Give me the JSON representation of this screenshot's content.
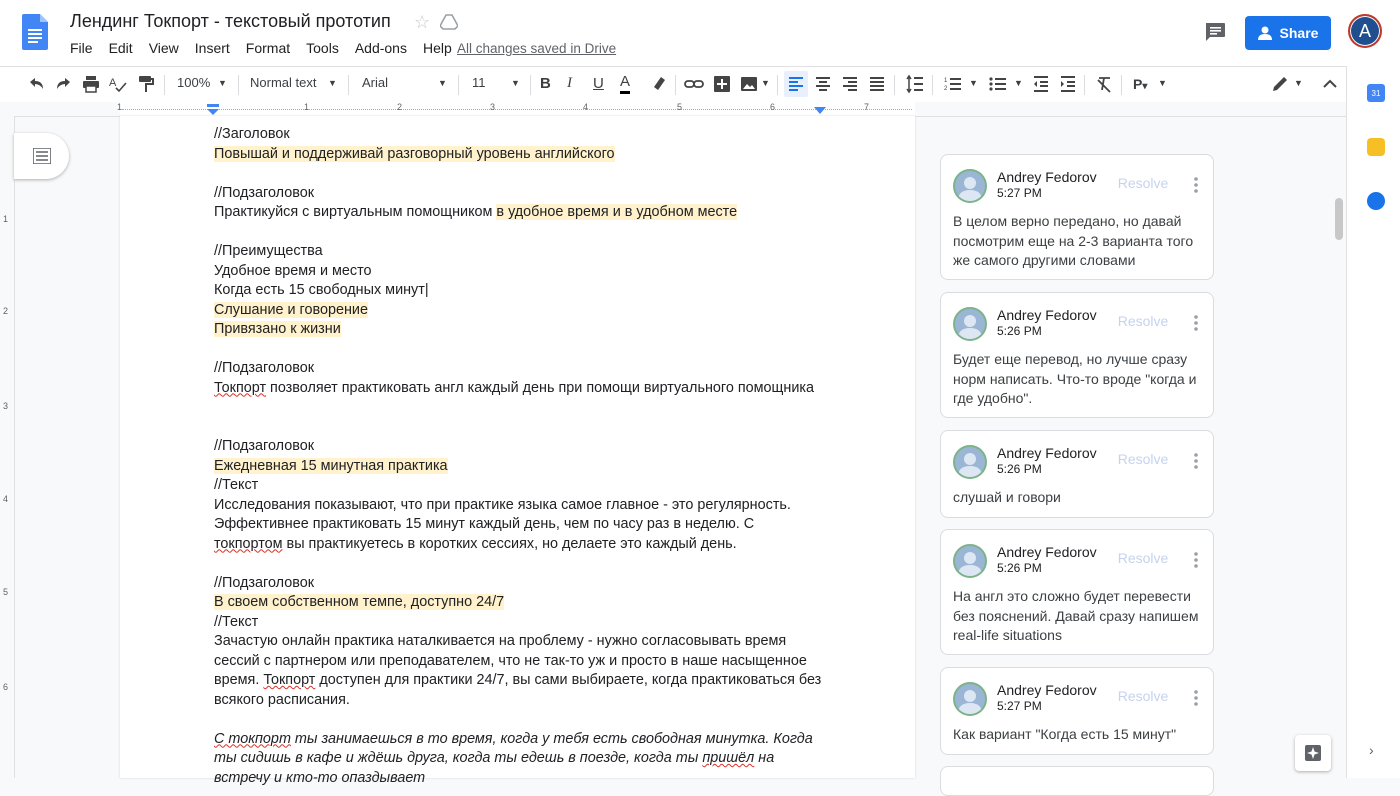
{
  "document": {
    "title": "Лендинг Токпорт - текстовый прототип",
    "saved_status": "All changes saved in Drive"
  },
  "menu": [
    "File",
    "Edit",
    "View",
    "Insert",
    "Format",
    "Tools",
    "Add-ons",
    "Help"
  ],
  "share_label": "Share",
  "user_initial": "A",
  "toolbar": {
    "zoom": "100%",
    "style": "Normal text",
    "font": "Arial",
    "size": "11"
  },
  "ruler_numbers": [
    "1",
    "1",
    "2",
    "3",
    "4",
    "5",
    "6",
    "7"
  ],
  "vruler_numbers": [
    "1",
    "2",
    "3",
    "4",
    "5",
    "6"
  ],
  "doc_lines": [
    {
      "segments": [
        {
          "text": "//Заголовок"
        }
      ]
    },
    {
      "segments": [
        {
          "text": "Повышай и поддерживай разговорный уровень английского",
          "hl": true
        }
      ]
    },
    {
      "segments": [
        {
          "text": ""
        }
      ]
    },
    {
      "segments": [
        {
          "text": "//Подзаголовок"
        }
      ]
    },
    {
      "segments": [
        {
          "text": "Практикуйся с виртуальным помощником "
        },
        {
          "text": "в удобное время и в удобном месте",
          "hl": true
        }
      ]
    },
    {
      "segments": [
        {
          "text": ""
        }
      ]
    },
    {
      "segments": [
        {
          "text": "//Преимущества"
        }
      ]
    },
    {
      "segments": [
        {
          "text": "Удобное время и место"
        }
      ]
    },
    {
      "segments": [
        {
          "text": "Когда есть 15 свободных минут|"
        }
      ]
    },
    {
      "segments": [
        {
          "text": "Слушание и говорение",
          "hl": true
        }
      ]
    },
    {
      "segments": [
        {
          "text": "Привязано к жизни",
          "hl": true
        }
      ]
    },
    {
      "segments": [
        {
          "text": ""
        }
      ]
    },
    {
      "segments": [
        {
          "text": "//Подзаголовок"
        }
      ]
    },
    {
      "segments": [
        {
          "text": "Токпорт",
          "sq": true
        },
        {
          "text": " позволяет практиковать англ каждый день при помощи виртуального помощника"
        }
      ]
    },
    {
      "segments": [
        {
          "text": ""
        }
      ]
    },
    {
      "segments": [
        {
          "text": ""
        }
      ]
    },
    {
      "segments": [
        {
          "text": "//Подзаголовок"
        }
      ]
    },
    {
      "segments": [
        {
          "text": "Ежедневная 15 минутная практика",
          "hl": true
        }
      ]
    },
    {
      "segments": [
        {
          "text": "//Текст"
        }
      ]
    },
    {
      "segments": [
        {
          "text": "Исследования показывают, что при практике языка самое главное - это регулярность."
        }
      ]
    },
    {
      "segments": [
        {
          "text": "Эффективнее практиковать 15 минут каждый день, чем по часу раз в неделю. С"
        }
      ]
    },
    {
      "segments": [
        {
          "text": "токпортом",
          "sq": true
        },
        {
          "text": " вы практикуетесь в коротких сессиях, но делаете это каждый день."
        }
      ]
    },
    {
      "segments": [
        {
          "text": ""
        }
      ]
    },
    {
      "segments": [
        {
          "text": "//Подзаголовок"
        }
      ]
    },
    {
      "segments": [
        {
          "text": "В своем собственном темпе, доступно 24/7",
          "hl": true
        }
      ]
    },
    {
      "segments": [
        {
          "text": "//Текст"
        }
      ]
    },
    {
      "segments": [
        {
          "text": "Зачастую онлайн практика наталкивается на проблему - нужно согласовывать время"
        }
      ]
    },
    {
      "segments": [
        {
          "text": "сессий с партнером или преподавателем, что не так-то уж и просто в наше насыщенное"
        }
      ]
    },
    {
      "segments": [
        {
          "text": "время. "
        },
        {
          "text": "Токпорт",
          "sq": true
        },
        {
          "text": " доступен для практики 24/7, вы сами выбираете, когда практиковаться без"
        }
      ]
    },
    {
      "segments": [
        {
          "text": "всякого расписания."
        }
      ]
    },
    {
      "segments": [
        {
          "text": ""
        }
      ]
    },
    {
      "segments": [
        {
          "text": " "
        },
        {
          "text": "С токпорт",
          "sq": true,
          "it": true
        },
        {
          "text": "  ты занимаешься в то время, когда у тебя есть свободная минутка. Когда",
          "it": true
        }
      ]
    },
    {
      "segments": [
        {
          "text": "ты сидишь в кафе и ждёшь друга, когда ты едешь в поезде, когда ты ",
          "it": true
        },
        {
          "text": "пришёл",
          "sq": true,
          "it": true
        },
        {
          "text": " на",
          "it": true
        }
      ]
    },
    {
      "segments": [
        {
          "text": "встречу и кто-то опаздывает",
          "it": true
        }
      ]
    }
  ],
  "comments": [
    {
      "author": "Andrey Fedorov",
      "time": "5:27 PM",
      "resolve": "Resolve",
      "text": "В целом верно передано, но давай посмотрим еще на 2-3 варианта того же самого другими словами"
    },
    {
      "author": "Andrey Fedorov",
      "time": "5:26 PM",
      "resolve": "Resolve",
      "text": "Будет еще перевод, но лучше сразу норм написать. Что-то вроде \"когда и где удобно\"."
    },
    {
      "author": "Andrey Fedorov",
      "time": "5:26 PM",
      "resolve": "Resolve",
      "text": "слушай и говори"
    },
    {
      "author": "Andrey Fedorov",
      "time": "5:26 PM",
      "resolve": "Resolve",
      "text": "На англ это сложно будет перевести без пояснений. Давай сразу напишем real-life situations"
    },
    {
      "author": "Andrey Fedorov",
      "time": "5:27 PM",
      "resolve": "Resolve",
      "text": "Как вариант \"Когда есть 15 минут\""
    }
  ],
  "colors": {
    "accent": "#1a73e8",
    "highlight": "#fff2cc",
    "share_bg": "#1a73e8"
  }
}
